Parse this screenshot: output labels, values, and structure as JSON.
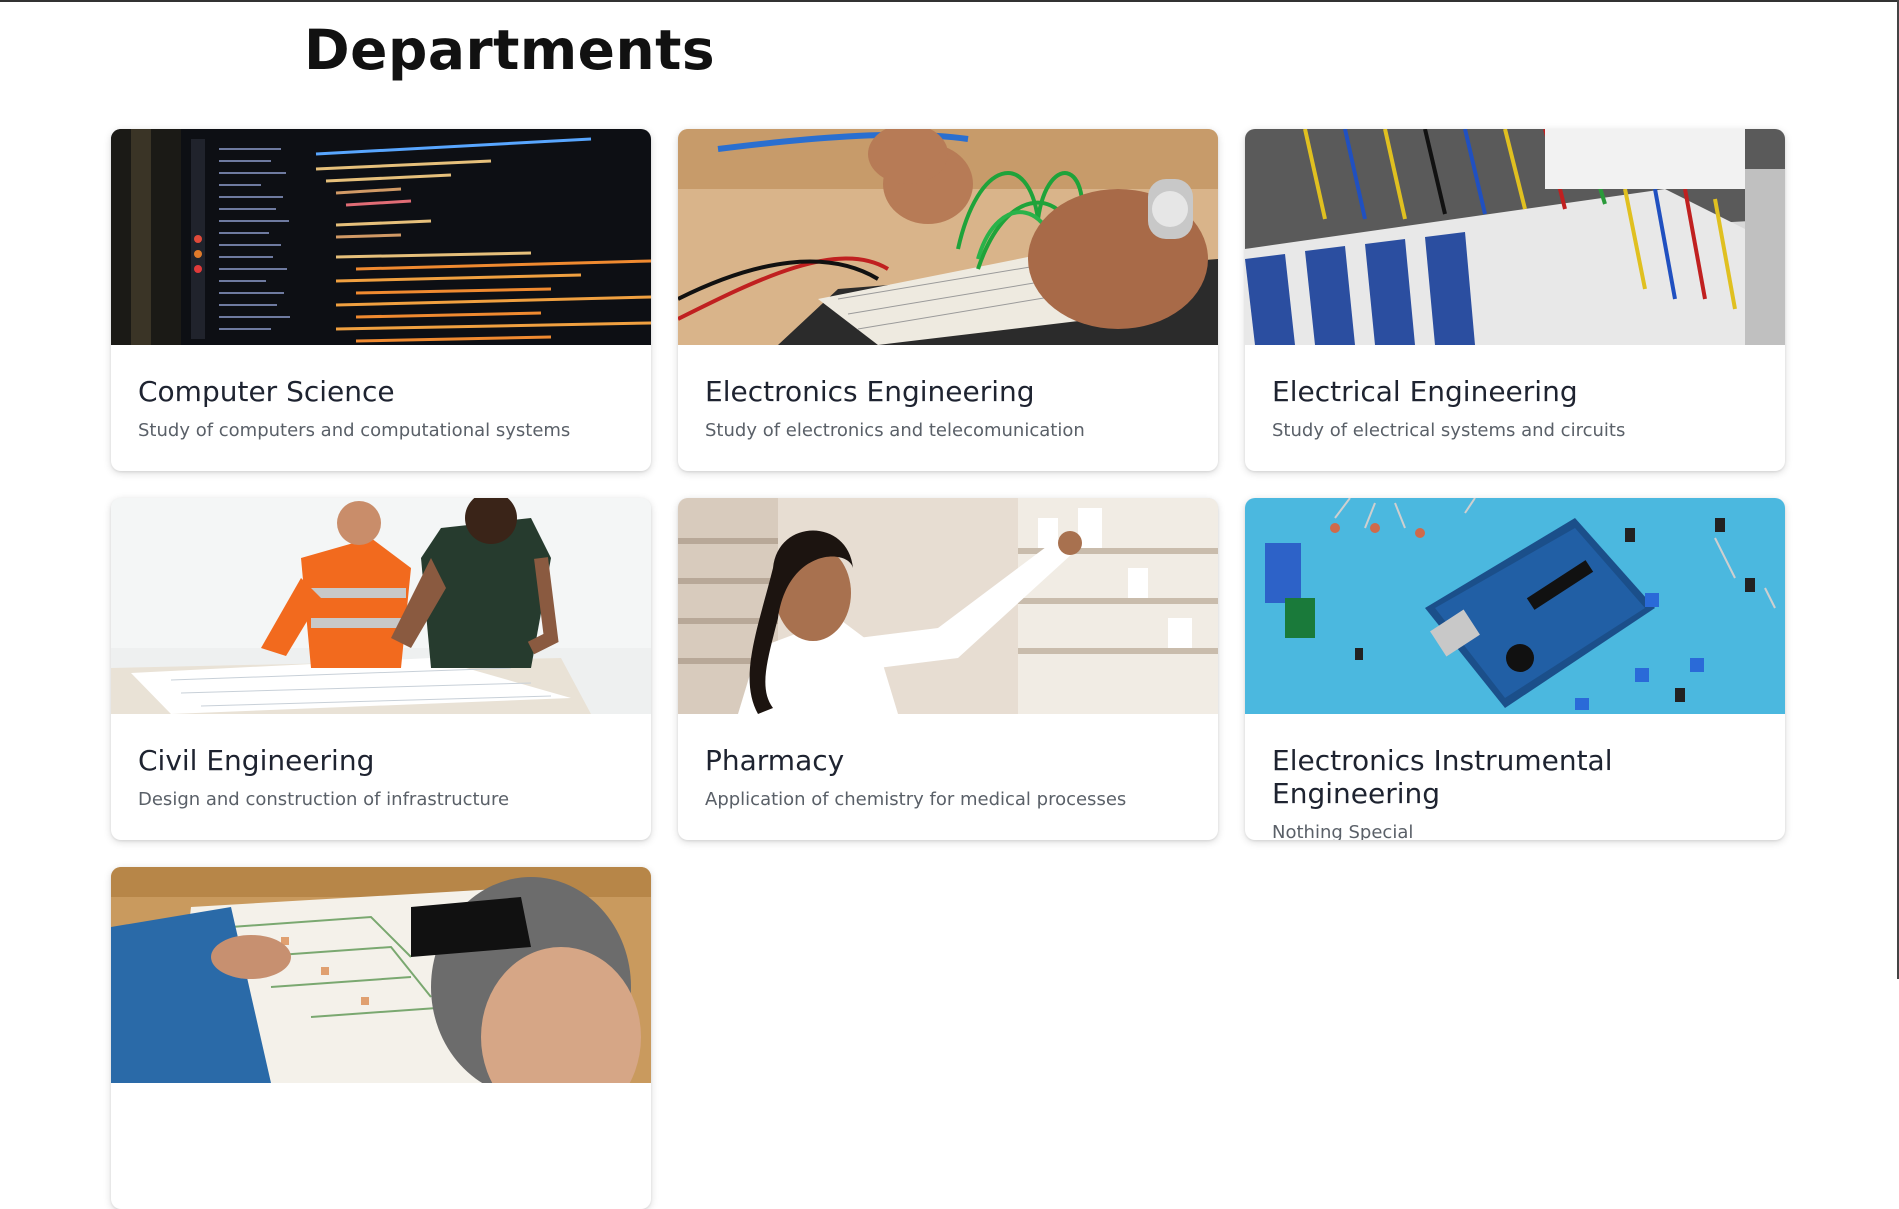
{
  "page": {
    "title": "Departments"
  },
  "departments": [
    {
      "title": "Computer Science",
      "description": "Study of computers and computational systems",
      "image": "code-editor-photo"
    },
    {
      "title": "Electronics Engineering",
      "description": "Study of electronics and telecomunication",
      "image": "breadboard-wiring-photo"
    },
    {
      "title": "Electrical Engineering",
      "description": "Study of electrical systems and circuits",
      "image": "electrical-panel-photo"
    },
    {
      "title": "Civil Engineering",
      "description": "Design and construction of infrastructure",
      "image": "blueprint-review-photo"
    },
    {
      "title": "Pharmacy",
      "description": "Application of chemistry for medical processes",
      "image": "pharmacist-shelves-photo"
    },
    {
      "title": "Electronics Instrumental Engineering",
      "description": "Nothing Special",
      "image": "arduino-board-photo"
    },
    {
      "title": "",
      "description": "",
      "image": "map-planning-photo"
    }
  ],
  "colors": {
    "title_text": "#111111",
    "card_title": "#1e2330",
    "card_text": "#5a6068"
  }
}
